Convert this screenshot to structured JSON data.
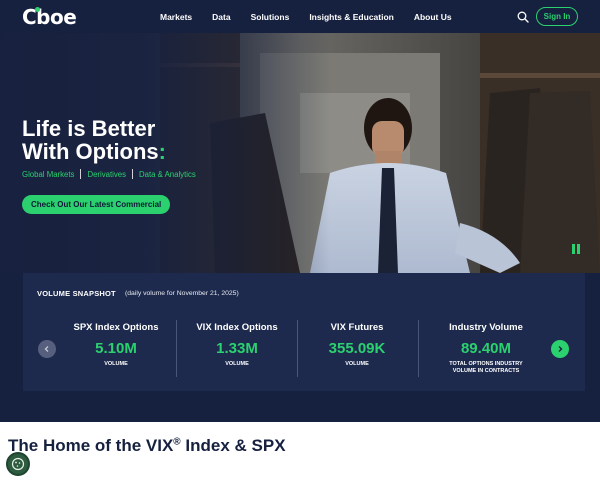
{
  "brand": {
    "logo_text": "Cboe",
    "accent": "#2bd16f",
    "navy": "#16203f"
  },
  "nav": {
    "items": [
      "Markets",
      "Data",
      "Solutions",
      "Insights & Education",
      "About Us"
    ],
    "search_icon": "search-icon",
    "signin_label": "Sign In"
  },
  "hero": {
    "title_line1": "Life is Better",
    "title_line2": "With Options",
    "title_colon": ":",
    "links": [
      "Global Markets",
      "Derivatives",
      "Data & Analytics"
    ],
    "cta_label": "Check Out Our Latest Commercial",
    "pause_icon": "pause-icon"
  },
  "volume": {
    "title": "VOLUME SNAPSHOT",
    "subtitle": "(daily volume for November 21, 2025)",
    "stats": [
      {
        "name": "SPX Index Options",
        "value": "5.10M",
        "label": "VOLUME"
      },
      {
        "name": "VIX Index Options",
        "value": "1.33M",
        "label": "VOLUME"
      },
      {
        "name": "VIX Futures",
        "value": "355.09K",
        "label": "VOLUME"
      },
      {
        "name": "Industry Volume",
        "value": "89.40M",
        "label": "TOTAL OPTIONS INDUSTRY VOLUME IN CONTRACTS"
      }
    ]
  },
  "section": {
    "title_pre": "The Home of the VIX",
    "title_sup": "®",
    "title_post": " Index & SPX"
  },
  "cookie": {
    "icon": "cookie-icon"
  }
}
